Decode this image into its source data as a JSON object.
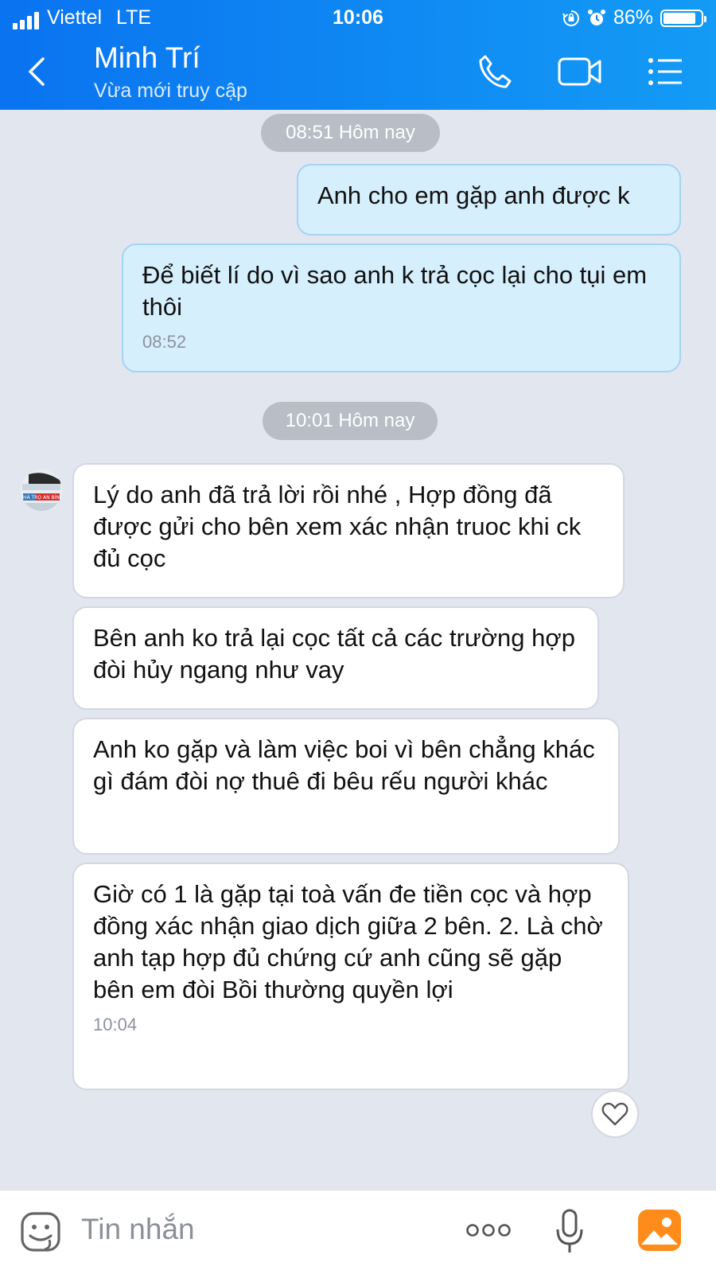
{
  "status_bar": {
    "carrier": "Viettel",
    "network": "LTE",
    "time": "10:06",
    "battery": "86%",
    "battery_level": 0.86
  },
  "header": {
    "name": "Minh Trí",
    "subtitle": "Vừa mới truy cập",
    "icons": [
      "back-icon",
      "phone-icon",
      "video-icon",
      "menu-icon"
    ],
    "color": "#0f86f2"
  },
  "messages": {
    "ts1": "08:51 Hôm nay",
    "m1": "Anh cho em gặp anh được k",
    "m2": "Để biết lí do vì sao anh k trả cọc lại cho tụi em thôi",
    "m2_time": "08:52",
    "ts2": "10:01 Hôm nay",
    "m3": "Lý do anh đã trả lời rồi nhé , Hợp đồng đã được gửi cho bên xem xác nhận truoc khi ck đủ cọc",
    "m4": "Bên anh ko trả lại cọc tất cả các trường hợp đòi hủy ngang như vay",
    "m5": "Anh ko gặp và làm việc boi vì bên chẳng khác gì đám đòi nợ thuê đi bêu rếu người khác",
    "m6": "Giờ có 1 là gặp tại toà vấn đe tiền cọc  và hợp đồng xác nhận giao dịch giữa 2 bên. 2. Là chờ anh tạp hợp đủ chứng cứ anh cũng sẽ gặp bên em đòi Bồi thường quyền lợi",
    "m6_time": "10:04"
  },
  "avatar_text": "NHÀ TRỌ AN BÌNH",
  "composer": {
    "placeholder": "Tin nhắn",
    "icons": [
      "sticker-icon",
      "more-icon",
      "microphone-icon",
      "image-icon"
    ]
  }
}
